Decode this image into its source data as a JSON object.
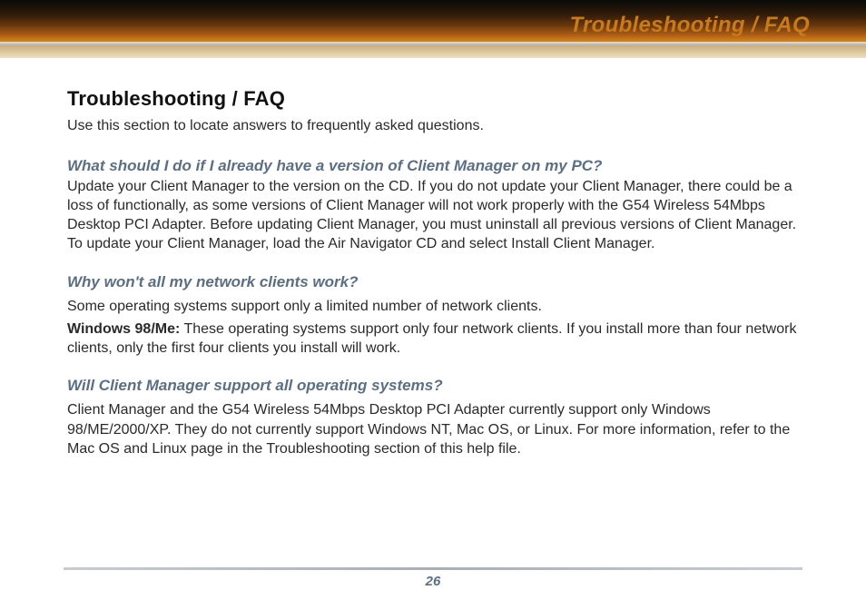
{
  "header": {
    "title": "Troubleshooting / FAQ"
  },
  "content": {
    "heading": "Troubleshooting / FAQ",
    "intro": "Use this section to locate answers to frequently asked questions.",
    "faq": [
      {
        "question": "What should I do if I already have a version of Client Manager on my PC?",
        "answer": "Update your Client Manager to the version on the CD.  If you do not update your Client Manager, there could be a loss of functionally, as some versions of Client Manager will not work properly with the G54 Wireless 54Mbps Desktop PCI Adapter.  Before updating Client Manager, you must uninstall all previous versions of Client Manager.  To update your Client Manager, load the Air Navigator CD and select Install Client Manager."
      },
      {
        "question": "Why won't all my network clients work?",
        "answer": "Some operating systems support only a limited number of network clients.",
        "extra_label": "Windows 98/Me:",
        "extra_text": " These operating systems support only four network clients. If you install more than four network clients, only the first four clients you install will work."
      },
      {
        "question": "Will Client Manager support all operating systems?",
        "answer": "Client Manager and the G54 Wireless 54Mbps Desktop PCI Adapter currently support only Windows 98/ME/2000/XP. They do not currently support Windows NT, Mac OS, or Linux. For more information, refer to the Mac OS and Linux page in the Troubleshooting section of this help file."
      }
    ]
  },
  "footer": {
    "page_number": "26"
  }
}
